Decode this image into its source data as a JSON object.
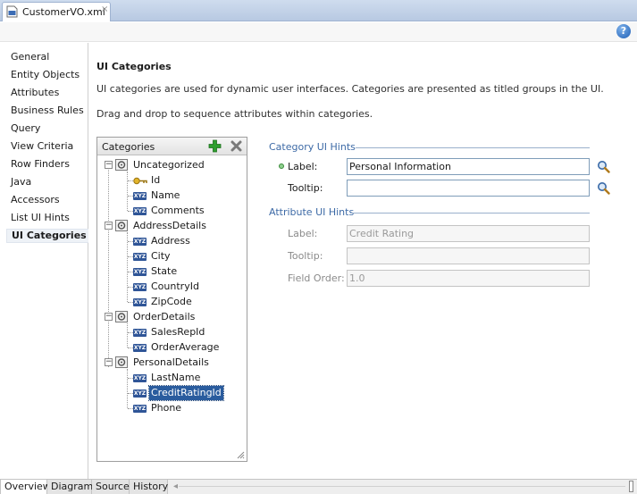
{
  "editor_tab": {
    "title": "CustomerVO.xml",
    "close": "×",
    "file_icon": "xml-file-icon"
  },
  "help": {
    "icon": "help-icon",
    "glyph": "?"
  },
  "left_nav": {
    "items": [
      {
        "label": "General"
      },
      {
        "label": "Entity Objects"
      },
      {
        "label": "Attributes"
      },
      {
        "label": "Business Rules"
      },
      {
        "label": "Query"
      },
      {
        "label": "View Criteria"
      },
      {
        "label": "Row Finders"
      },
      {
        "label": "Java"
      },
      {
        "label": "Accessors"
      },
      {
        "label": "List UI Hints"
      },
      {
        "label": "UI Categories",
        "selected": true
      }
    ]
  },
  "main": {
    "title": "UI Categories",
    "description1": "UI categories are used for dynamic user interfaces. Categories are presented as titled groups in the UI.",
    "description2": "Drag and drop to sequence attributes within categories."
  },
  "categories": {
    "header": "Categories",
    "add_icon": "add-icon",
    "remove_icon": "remove-icon",
    "groups": [
      {
        "name": "Uncategorized",
        "items": [
          "Id",
          "Name",
          "Comments"
        ]
      },
      {
        "name": "AddressDetails",
        "items": [
          "Address",
          "City",
          "State",
          "CountryId",
          "ZipCode"
        ]
      },
      {
        "name": "OrderDetails",
        "items": [
          "SalesRepId",
          "OrderAverage"
        ]
      },
      {
        "name": "PersonalDetails",
        "items": [
          "LastName",
          "CreditRatingId",
          "Phone"
        ]
      }
    ],
    "selected_item": "CreditRatingId",
    "attr_icon_text": "XYZ"
  },
  "category_hints": {
    "title": "Category UI Hints",
    "label_label": "Label:",
    "label_value": "Personal Information",
    "tooltip_label": "Tooltip:",
    "tooltip_value": ""
  },
  "attribute_hints": {
    "title": "Attribute UI Hints",
    "label_label": "Label:",
    "label_value": "Credit Rating",
    "tooltip_label": "Tooltip:",
    "tooltip_value": "",
    "field_order_label": "Field Order:",
    "field_order_value": "1.0"
  },
  "bottom_tabs": [
    {
      "label": "Overview",
      "active": true
    },
    {
      "label": "Diagram"
    },
    {
      "label": "Source"
    },
    {
      "label": "History"
    }
  ],
  "colors": {
    "accent": "#3d6aa6",
    "selection": "#2a5c9e",
    "add_green": "#2e9e2e"
  }
}
